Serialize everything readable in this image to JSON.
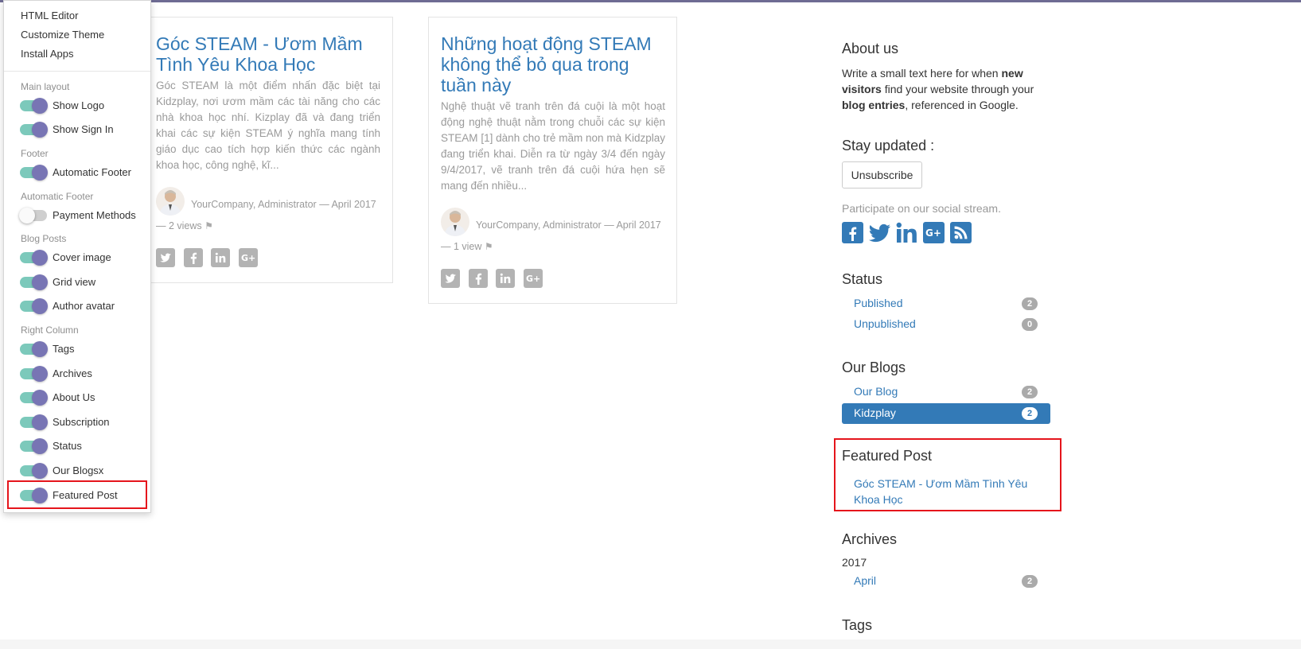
{
  "menu": {
    "links": [
      "HTML Editor",
      "Customize Theme",
      "Install Apps"
    ],
    "sections": [
      {
        "header": "Main layout"
      },
      {
        "header": "Footer"
      },
      {
        "header": "Automatic Footer"
      },
      {
        "header": "Blog Posts"
      },
      {
        "header": "Right Column"
      }
    ],
    "options": [
      {
        "label": "Show Logo",
        "enabled": true
      },
      {
        "label": "Show Sign In",
        "enabled": true
      },
      {
        "label": "Automatic Footer",
        "enabled": true
      },
      {
        "label": "Payment Methods",
        "enabled": false
      },
      {
        "label": "Cover image",
        "enabled": true
      },
      {
        "label": "Grid view",
        "enabled": true
      },
      {
        "label": "Author avatar",
        "enabled": true
      },
      {
        "label": "Tags",
        "enabled": true
      },
      {
        "label": "Archives",
        "enabled": true
      },
      {
        "label": "About Us",
        "enabled": true
      },
      {
        "label": "Subscription",
        "enabled": true
      },
      {
        "label": "Status",
        "enabled": true
      },
      {
        "label": "Our Blogsx",
        "enabled": true
      },
      {
        "label": "Featured Post",
        "enabled": true
      }
    ]
  },
  "posts": [
    {
      "title": "Góc STEAM - Ươm Mầm Tình Yêu Khoa Học",
      "teaser": "Góc STEAM là một điểm nhấn đặc biệt tại Kidzplay, nơi ươm mầm các tài năng cho các nhà khoa học nhí. Kizplay đã và đang triển khai các sự kiện STEAM ý nghĩa mang tính giáo dục cao tích hợp kiến thức  các ngành khoa học, công nghệ, kĩ...",
      "meta": "YourCompany, Administrator — April 2017 — 2 views"
    },
    {
      "title": "Những hoạt động STEAM không thể bỏ qua trong tuần này",
      "teaser": "Nghệ thuật vẽ tranh trên đá cuội là một hoạt động nghệ thuật nằm trong chuỗi các sự kiện  STEAM [1]  dành cho trẻ mầm non mà Kidzplay đang triển khai. Diễn ra từ ngày 3/4 đến ngày 9/4/2017, vẽ tranh trên đá cuội hứa hẹn sẽ mang đến nhiều...",
      "meta": "YourCompany, Administrator — April 2017 — 1 view"
    }
  ],
  "share_icons": [
    "twitter-icon",
    "facebook-icon",
    "linkedin-icon",
    "google-plus-icon"
  ],
  "right": {
    "about": {
      "title": "About us",
      "t1": "Write a small text here for when ",
      "b1": "new visitors",
      "t2": " find your website through your ",
      "b2": "blog entries",
      "t3": ", referenced in Google."
    },
    "stay": {
      "title": "Stay updated :",
      "button": "Unsubscribe"
    },
    "social": {
      "text": "Participate on our social stream.",
      "icons": [
        "facebook-icon",
        "twitter-icon",
        "linkedin-icon",
        "google-plus-icon",
        "rss-icon"
      ],
      "color": "#337ab7"
    },
    "status": {
      "title": "Status",
      "items": [
        {
          "label": "Published",
          "count": "2"
        },
        {
          "label": "Unpublished",
          "count": "0"
        }
      ]
    },
    "blogs": {
      "title": "Our Blogs",
      "items": [
        {
          "label": "Our Blog",
          "count": "2",
          "active": false
        },
        {
          "label": "Kidzplay",
          "count": "2",
          "active": true
        }
      ]
    },
    "featured": {
      "title": "Featured Post",
      "link": "Góc STEAM - Ươm Mầm Tình Yêu Khoa Học"
    },
    "archives": {
      "title": "Archives",
      "year": "2017",
      "items": [
        {
          "label": "April",
          "count": "2"
        }
      ]
    },
    "tags": {
      "title": "Tags"
    }
  },
  "colors": {
    "link": "#337ab7",
    "highlight": "#e5151c",
    "toggle_track": "#7cc9bb",
    "toggle_knob": "#7875b4"
  }
}
